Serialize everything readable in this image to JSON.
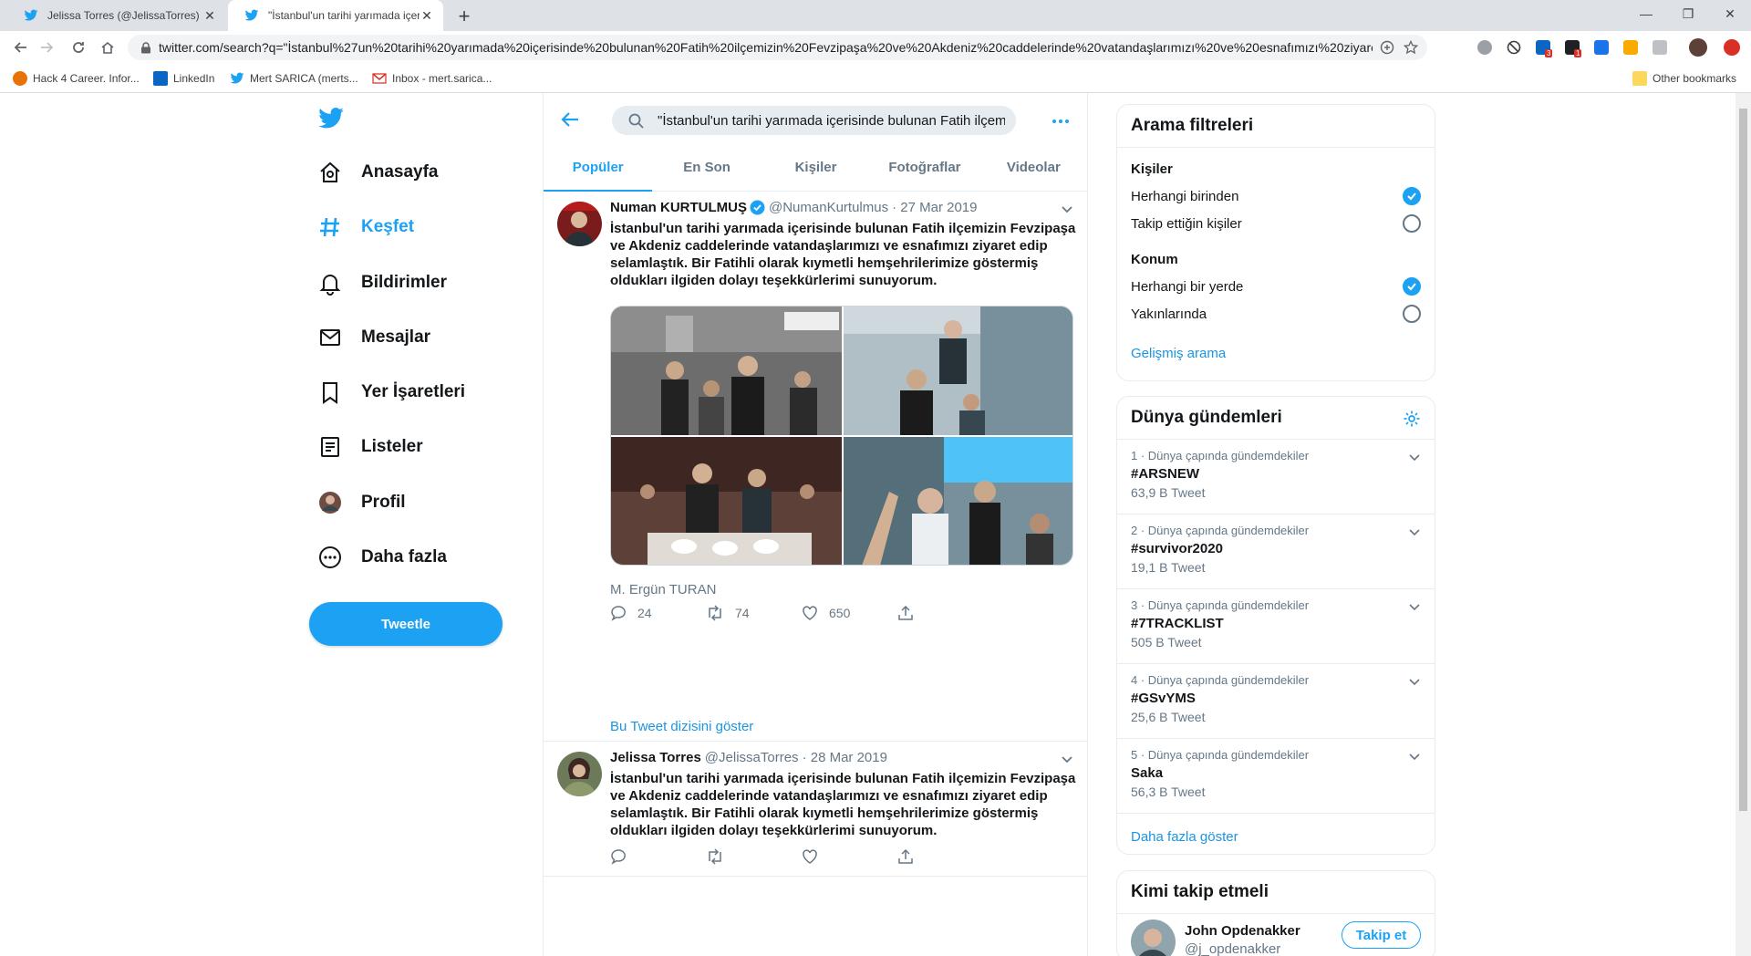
{
  "browser": {
    "tabs": [
      {
        "label": "Jelissa Torres (@JelissaTorres) / Twitter",
        "active": false
      },
      {
        "label": "\"İstanbul'un tarihi yarımada içerisinde",
        "active": true
      }
    ],
    "new_tab": "+",
    "address": "twitter.com/search?q=\"İstanbul%27un%20tarihi%20yarımada%20içerisinde%20bulunan%20Fatih%20ilçemizin%20Fevzipaşa%20ve%20Akdeniz%20caddelerinde%20vatandaşlarımızı%20ve%20esnafımızı%20ziyaret%20edi...",
    "bookmarks": [
      {
        "label": "Hack 4 Career. Infor...",
        "icon": "hack4career-icon",
        "color": "#e8710a"
      },
      {
        "label": "LinkedIn",
        "icon": "linkedin-icon",
        "color": "#0a66c2"
      },
      {
        "label": "Mert SARICA (merts...",
        "icon": "twitter-icon",
        "color": "#1da1f2"
      },
      {
        "label": "Inbox - mert.sarica...",
        "icon": "gmail-icon",
        "color": "#d93025"
      }
    ],
    "other_bookmarks": "Other bookmarks",
    "ext_badges": {
      "linkedin": "3",
      "ext2": "1"
    }
  },
  "nav": {
    "items": [
      {
        "label": "Anasayfa",
        "icon": "home-icon",
        "active": false
      },
      {
        "label": "Keşfet",
        "icon": "hashtag-icon",
        "active": true
      },
      {
        "label": "Bildirimler",
        "icon": "bell-icon",
        "active": false
      },
      {
        "label": "Mesajlar",
        "icon": "mail-icon",
        "active": false
      },
      {
        "label": "Yer İşaretleri",
        "icon": "bookmark-icon",
        "active": false
      },
      {
        "label": "Listeler",
        "icon": "list-icon",
        "active": false
      },
      {
        "label": "Profil",
        "icon": "profile-avatar-icon",
        "active": false
      },
      {
        "label": "Daha fazla",
        "icon": "more-circle-icon",
        "active": false
      }
    ],
    "tweet_button": "Tweetle"
  },
  "search": {
    "query": "\"İstanbul'un tarihi yarımada içerisinde bulunan Fatih ilçemi",
    "tabs": [
      "Popüler",
      "En Son",
      "Kişiler",
      "Fotoğraflar",
      "Videolar"
    ],
    "active_tab": "Popüler"
  },
  "tweets": [
    {
      "name": "Numan KURTULMUŞ",
      "verified": true,
      "handle": "@NumanKurtulmus",
      "date": "· 27 Mar 2019",
      "text": "İstanbul'un tarihi yarımada içerisinde bulunan Fatih ilçemizin Fevzipaşa ve Akdeniz caddelerinde vatandaşlarımızı ve esnafımızı ziyaret edip selamlaştık. Bir Fatihli olarak kıymetli hemşehrilerimize göstermiş oldukları ilgiden dolayı teşekkürlerimi sunuyorum.",
      "tagged": "M. Ergün TURAN",
      "replies": "24",
      "retweets": "74",
      "likes": "650",
      "thread_link": "Bu Tweet dizisini göster"
    },
    {
      "name": "Jelissa Torres",
      "verified": false,
      "handle": "@JelissaTorres",
      "date": "· 28 Mar 2019",
      "text": "İstanbul'un tarihi yarımada içerisinde bulunan Fatih ilçemizin Fevzipaşa ve Akdeniz caddelerinde vatandaşlarımızı ve esnafımızı ziyaret edip selamlaştık. Bir Fatihli olarak kıymetli hemşehrilerimize göstermiş oldukları ilgiden dolayı teşekkürlerimi sunuyorum."
    }
  ],
  "filters": {
    "title": "Arama filtreleri",
    "people_heading": "Kişiler",
    "people_options": [
      {
        "label": "Herhangi birinden",
        "checked": true
      },
      {
        "label": "Takip ettiğin kişiler",
        "checked": false
      }
    ],
    "location_heading": "Konum",
    "location_options": [
      {
        "label": "Herhangi bir yerde",
        "checked": true
      },
      {
        "label": "Yakınlarında",
        "checked": false
      }
    ],
    "advanced_link": "Gelişmiş arama"
  },
  "trends": {
    "title": "Dünya gündemleri",
    "items": [
      {
        "meta": "1 · Dünya çapında gündemdekiler",
        "name": "#ARSNEW",
        "count": "63,9 B Tweet"
      },
      {
        "meta": "2 · Dünya çapında gündemdekiler",
        "name": "#survivor2020",
        "count": "19,1 B Tweet"
      },
      {
        "meta": "3 · Dünya çapında gündemdekiler",
        "name": "#7TRACKLIST",
        "count": "505 B Tweet"
      },
      {
        "meta": "4 · Dünya çapında gündemdekiler",
        "name": "#GSvYMS",
        "count": "25,6 B Tweet"
      },
      {
        "meta": "5 · Dünya çapında gündemdekiler",
        "name": "Saka",
        "count": "56,3 B Tweet"
      }
    ],
    "show_more": "Daha fazla göster"
  },
  "who_to_follow": {
    "title": "Kimi takip etmeli",
    "name": "John Opdenakker",
    "handle": "@j_opdenakker",
    "button": "Takip et"
  },
  "colors": {
    "accent": "#1da1f2",
    "text": "#14171a",
    "muted": "#657786",
    "border": "#e6ecf0"
  }
}
